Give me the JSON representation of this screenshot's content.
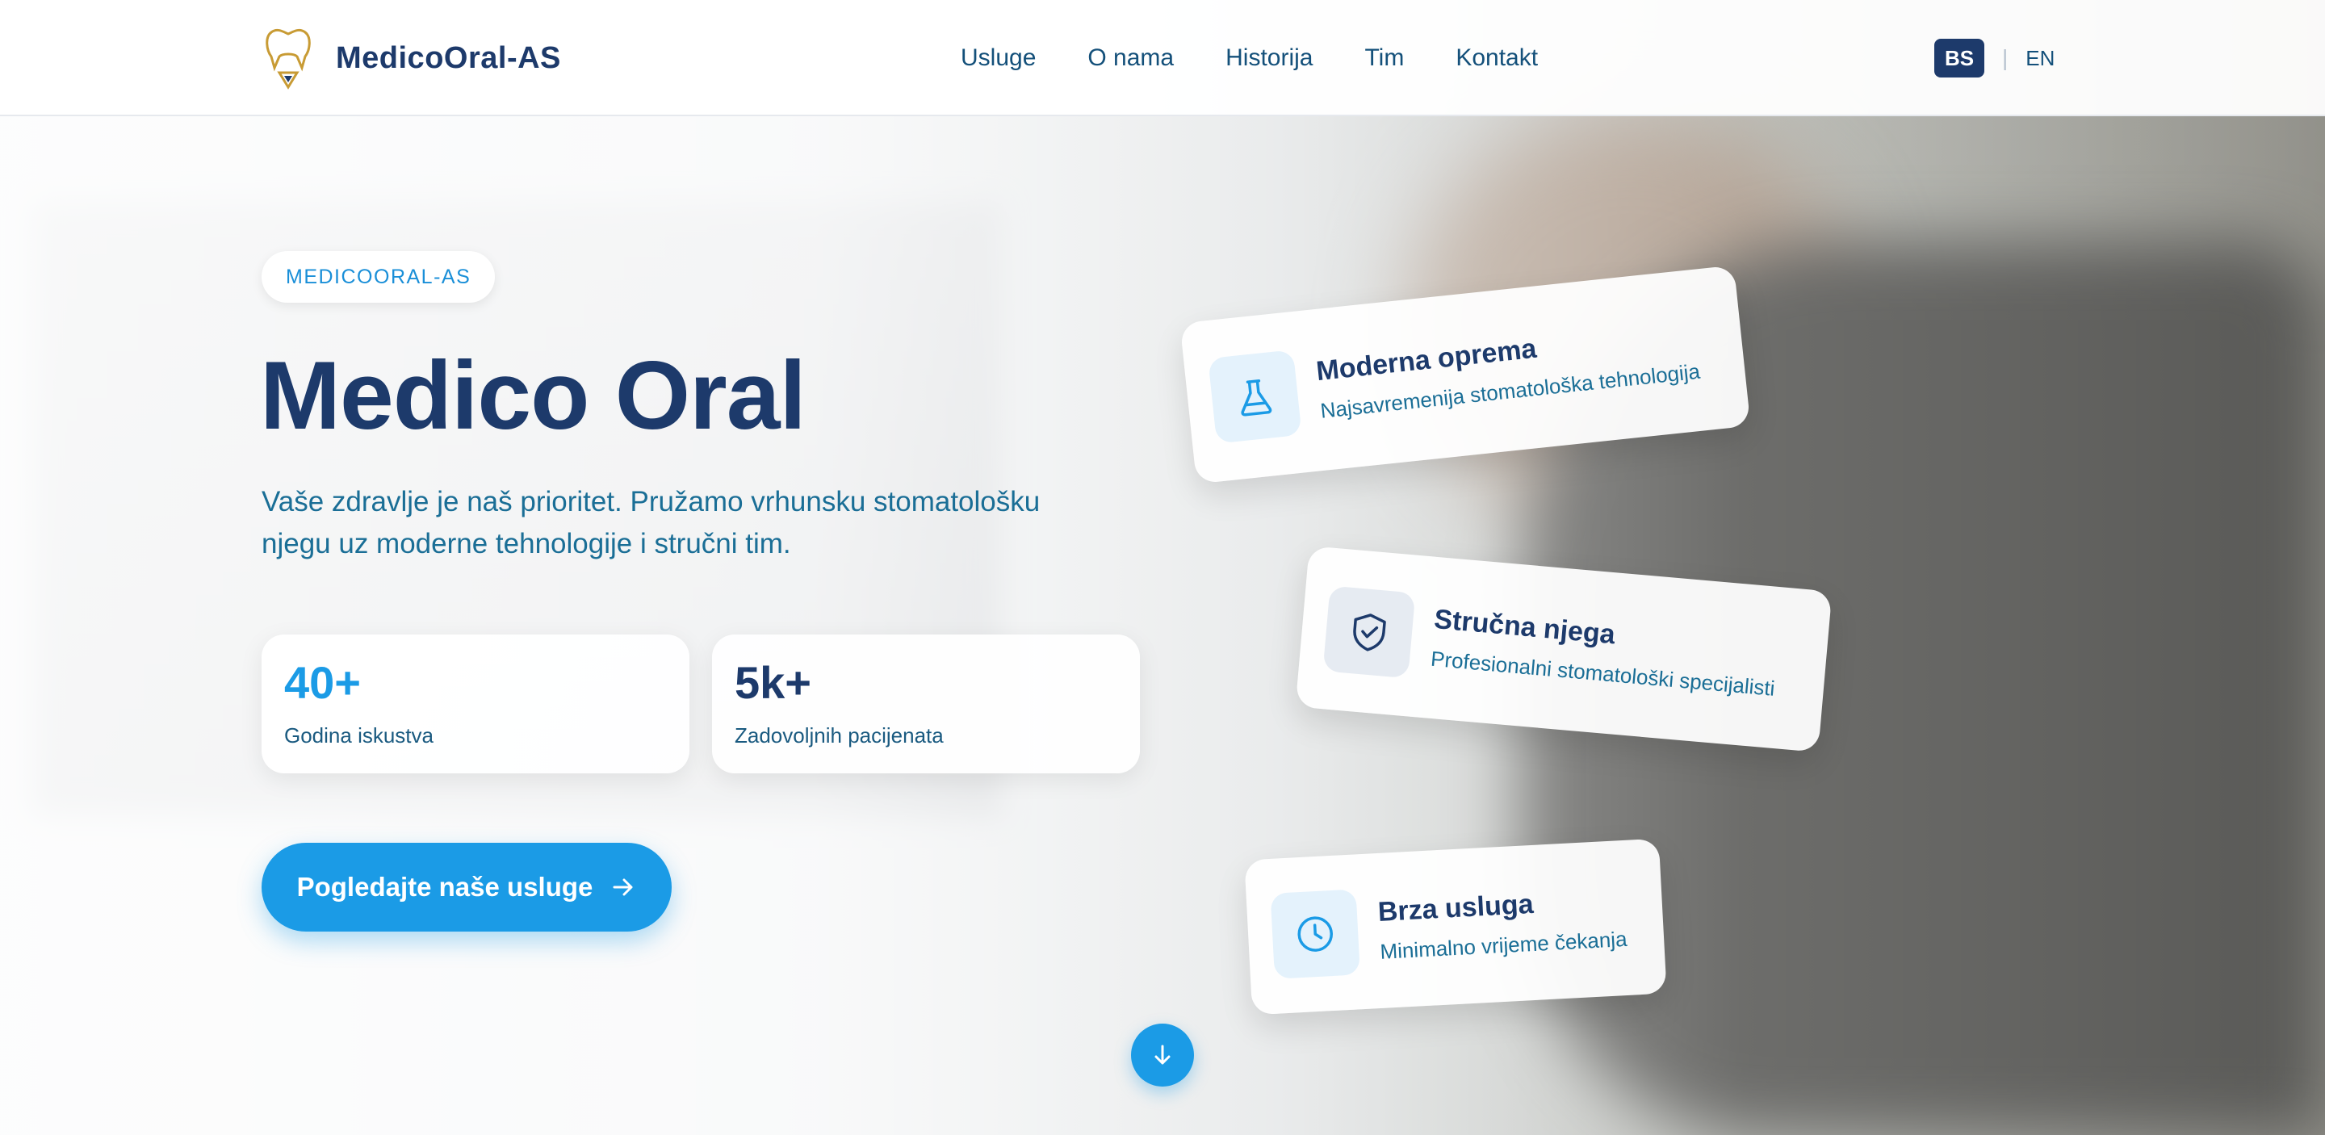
{
  "header": {
    "brand_name": "MedicoOral-AS",
    "nav": [
      "Usluge",
      "O nama",
      "Historija",
      "Tim",
      "Kontakt"
    ],
    "lang_active": "BS",
    "lang_separator": "|",
    "lang_other": "EN"
  },
  "hero": {
    "badge": "MEDICOORAL-AS",
    "title": "Medico Oral",
    "subtitle_line1": "Vaše zdravlje je naš prioritet. Pružamo vrhunsku stomatološku",
    "subtitle_line2": "njegu uz moderne tehnologije i stručni tim.",
    "stats": [
      {
        "value": "40+",
        "label": "Godina iskustva",
        "color": "#1b9be6"
      },
      {
        "value": "5k+",
        "label": "Zadovoljnih pacijenata",
        "color": "#1d3a6b"
      }
    ],
    "cta_label": "Pogledajte naše usluge"
  },
  "features": [
    {
      "title": "Moderna oprema",
      "desc": "Najsavremenija stomatološka tehnologija",
      "icon": "flask-icon"
    },
    {
      "title": "Stručna njega",
      "desc": "Profesionalni stomatološki specijalisti",
      "icon": "shield-check-icon"
    },
    {
      "title": "Brza usluga",
      "desc": "Minimalno vrijeme čekanja",
      "icon": "clock-icon"
    }
  ],
  "colors": {
    "primary": "#1b9be6",
    "navy": "#1d3a6b",
    "text_teal": "#1a6e96"
  }
}
